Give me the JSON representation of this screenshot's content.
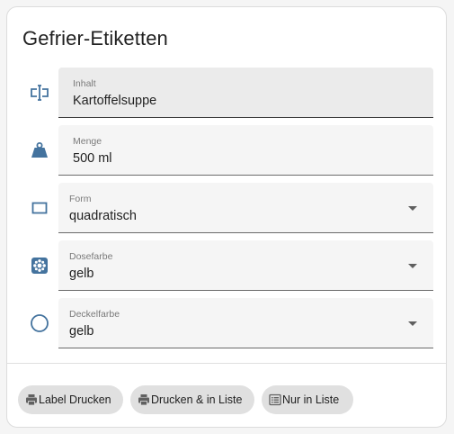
{
  "card": {
    "title": "Gefrier-Etiketten"
  },
  "fields": [
    {
      "id": "inhalt",
      "label": "Inhalt",
      "value": "Kartoffelsuppe",
      "kind": "text",
      "icon": "label-text-icon"
    },
    {
      "id": "menge",
      "label": "Menge",
      "value": "500 ml",
      "kind": "text",
      "icon": "weight-icon"
    },
    {
      "id": "form",
      "label": "Form",
      "value": "quadratisch",
      "kind": "select",
      "icon": "rectangle-outline-icon"
    },
    {
      "id": "dosefarbe",
      "label": "Dosefarbe",
      "value": "gelb",
      "kind": "select",
      "icon": "palette-icon"
    },
    {
      "id": "deckelfarbe",
      "label": "Deckelfarbe",
      "value": "gelb",
      "kind": "select",
      "icon": "circle-outline-icon"
    }
  ],
  "buttons": [
    {
      "id": "label-drucken",
      "label": "Label Drucken",
      "icon": "printer-icon"
    },
    {
      "id": "drucken-liste",
      "label": "Drucken & in Liste",
      "icon": "printer-icon"
    },
    {
      "id": "nur-liste",
      "label": "Nur in Liste",
      "icon": "list-icon"
    }
  ],
  "colors": {
    "icon": "#44739e",
    "card_background": "#ffffff",
    "field_background": "#f5f5f5",
    "button_background": "#e0e0e0"
  }
}
